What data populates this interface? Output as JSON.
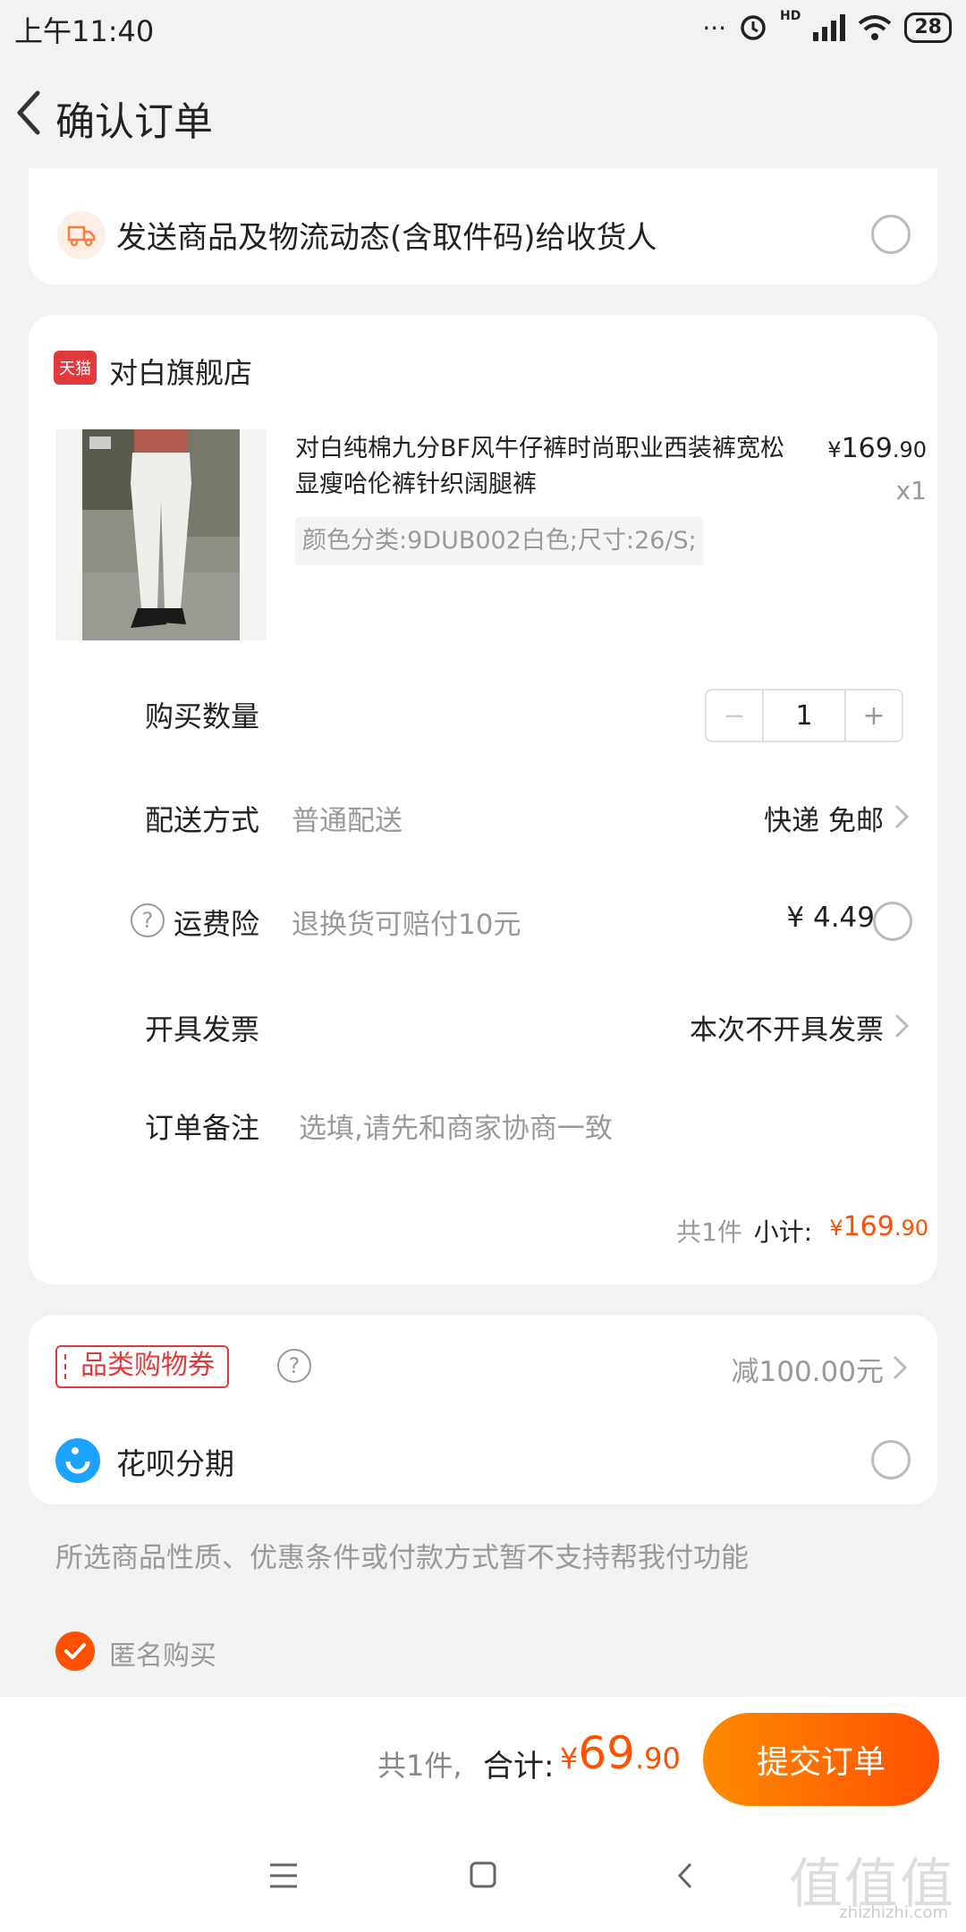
{
  "status_bar": {
    "time": "上午11:40",
    "dots": "···",
    "hd": "HD",
    "battery": "28"
  },
  "header": {
    "title": "确认订单"
  },
  "notify": {
    "text": "发送商品及物流动态(含取件码)给收货人"
  },
  "shop": {
    "badge": "天猫",
    "name": "对白旗舰店",
    "product": {
      "title": "对白纯棉九分BF风牛仔裤时尚职业西装裤宽松显瘦哈伦裤针织阔腿裤",
      "price_symbol": "¥",
      "price_int": "169",
      "price_dec": ".90",
      "qty": "x1",
      "sku": "颜色分类:9DUB002白色;尺寸:26/S;"
    },
    "quantity": {
      "label": "购买数量",
      "value": "1",
      "minus": "−",
      "plus": "+"
    },
    "delivery": {
      "label": "配送方式",
      "sub": "普通配送",
      "value": "快递 免邮"
    },
    "insurance": {
      "label": "运费险",
      "sub": "退换货可赔付10元",
      "value": "¥ 4.49"
    },
    "invoice": {
      "label": "开具发票",
      "value": "本次不开具发票"
    },
    "remark": {
      "label": "订单备注",
      "placeholder": "选填,请先和商家协商一致"
    },
    "subtotal": {
      "count": "共1件",
      "label": "小计:",
      "symbol": "¥",
      "int": "169",
      "dec": ".90"
    }
  },
  "coupon": {
    "tag": "品类购物券",
    "value": "减100.00元"
  },
  "huabei": {
    "label": "花呗分期"
  },
  "pay_note": "所选商品性质、优惠条件或付款方式暂不支持帮我付功能",
  "anonymous": {
    "label": "匿名购买",
    "checked": true
  },
  "footer": {
    "count": "共1件,",
    "label": "合计:",
    "symbol": "¥",
    "int": "69",
    "dec": ".90",
    "submit": "提交订单"
  },
  "watermark": {
    "text": "值值值",
    "sub": "zhizhizhi.com"
  },
  "colors": {
    "accent": "#ff5000",
    "tmall_red": "#e4393c",
    "huabei_blue": "#1aa3ff"
  }
}
